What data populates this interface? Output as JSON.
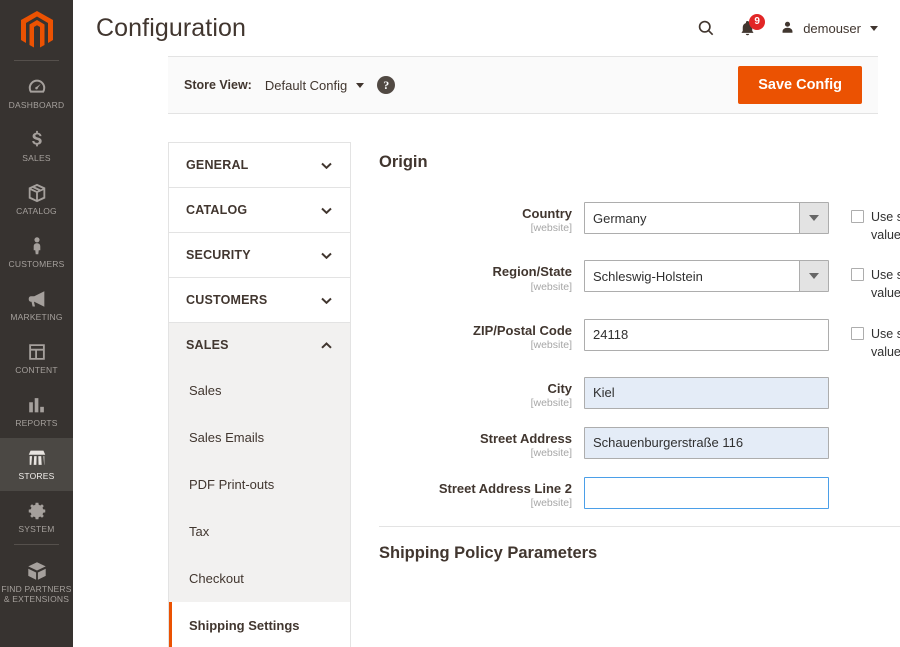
{
  "brand": {
    "logo_icon": "magento-logo-icon",
    "logo_color": "#eb5202"
  },
  "admin_nav": {
    "items": [
      {
        "label": "DASHBOARD",
        "icon": "dashboard-icon",
        "active": false
      },
      {
        "label": "SALES",
        "icon": "dollar-icon",
        "active": false
      },
      {
        "label": "CATALOG",
        "icon": "box-icon",
        "active": false
      },
      {
        "label": "CUSTOMERS",
        "icon": "person-icon",
        "active": false
      },
      {
        "label": "MARKETING",
        "icon": "megaphone-icon",
        "active": false
      },
      {
        "label": "CONTENT",
        "icon": "layout-icon",
        "active": false
      },
      {
        "label": "REPORTS",
        "icon": "bar-chart-icon",
        "active": false
      },
      {
        "label": "STORES",
        "icon": "storefront-icon",
        "active": true
      },
      {
        "label": "SYSTEM",
        "icon": "gear-icon",
        "active": false
      },
      {
        "label": "FIND PARTNERS\n& EXTENSIONS",
        "icon": "package-icon",
        "active": false
      }
    ]
  },
  "header": {
    "title": "Configuration",
    "search_icon": "search-icon",
    "notifications_icon": "bell-icon",
    "notifications_count": "9",
    "user_icon": "user-avatar-icon",
    "user_name": "demouser",
    "user_caret_icon": "caret-down-icon"
  },
  "page_actions": {
    "store_view_label": "Store View:",
    "store_view_value": "Default Config",
    "store_view_caret_icon": "caret-down-icon",
    "help_icon": "question-mark-icon",
    "help_glyph": "?",
    "save_label": "Save Config",
    "save_color": "#eb5202"
  },
  "config_nav": {
    "sections": [
      {
        "title": "GENERAL",
        "expanded": false,
        "chevron": "chevron-down-icon"
      },
      {
        "title": "CATALOG",
        "expanded": false,
        "chevron": "chevron-down-icon"
      },
      {
        "title": "SECURITY",
        "expanded": false,
        "chevron": "chevron-down-icon"
      },
      {
        "title": "CUSTOMERS",
        "expanded": false,
        "chevron": "chevron-down-icon"
      },
      {
        "title": "SALES",
        "expanded": true,
        "chevron": "chevron-up-icon"
      }
    ],
    "sales_items": [
      {
        "label": "Sales",
        "current": false
      },
      {
        "label": "Sales Emails",
        "current": false
      },
      {
        "label": "PDF Print-outs",
        "current": false
      },
      {
        "label": "Tax",
        "current": false
      },
      {
        "label": "Checkout",
        "current": false
      },
      {
        "label": "Shipping Settings",
        "current": true
      }
    ]
  },
  "content": {
    "origin": {
      "title": "Origin",
      "collapse_icon": "chevron-up-circle-icon",
      "fields": [
        {
          "label": "Country",
          "scope": "[website]",
          "type": "select",
          "value": "Germany",
          "dropdown_icon": "caret-down-icon",
          "inherit_label": "Use system value",
          "inherit_checked": false,
          "state": "normal"
        },
        {
          "label": "Region/State",
          "scope": "[website]",
          "type": "select",
          "value": "Schleswig-Holstein",
          "dropdown_icon": "caret-down-icon",
          "inherit_label": "Use system value",
          "inherit_checked": false,
          "state": "normal"
        },
        {
          "label": "ZIP/Postal Code",
          "scope": "[website]",
          "type": "text",
          "value": "24118",
          "placeholder": "",
          "inherit_label": "Use system value",
          "inherit_checked": false,
          "state": "normal"
        },
        {
          "label": "City",
          "scope": "[website]",
          "type": "text",
          "value": "Kiel",
          "placeholder": "",
          "inherit_label": "",
          "inherit_checked": false,
          "state": "changed"
        },
        {
          "label": "Street Address",
          "scope": "[website]",
          "type": "text",
          "value": "Schauenburgerstraße 116",
          "placeholder": "",
          "inherit_label": "",
          "inherit_checked": false,
          "state": "changed"
        },
        {
          "label": "Street Address Line 2",
          "scope": "[website]",
          "type": "text",
          "value": "",
          "placeholder": "",
          "inherit_label": "",
          "inherit_checked": false,
          "state": "focused"
        }
      ]
    },
    "shipping_policy": {
      "title": "Shipping Policy Parameters",
      "collapse_icon": "chevron-down-circle-icon"
    }
  }
}
